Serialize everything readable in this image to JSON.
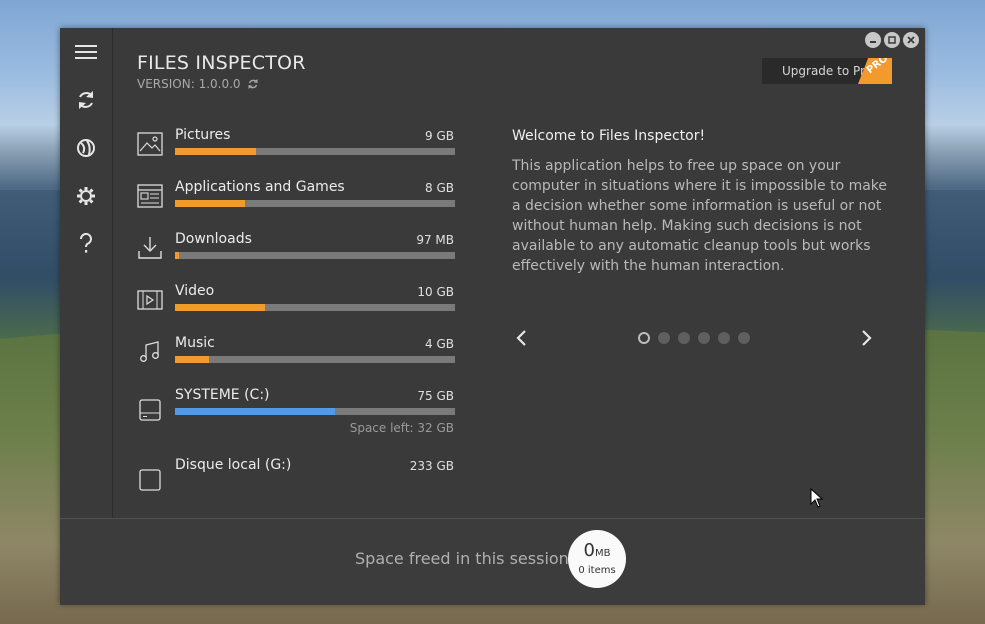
{
  "app": {
    "title": "FILES INSPECTOR",
    "version": "VERSION: 1.0.0.0",
    "upgrade_label": "Upgrade to Pro",
    "pro_badge": "PRO"
  },
  "sidebar": {
    "items": [
      {
        "icon": "menu-icon"
      },
      {
        "icon": "refresh-icon"
      },
      {
        "icon": "globe-icon"
      },
      {
        "icon": "gear-icon"
      },
      {
        "icon": "help-icon"
      }
    ]
  },
  "window_controls": [
    "minimize",
    "maximize",
    "close"
  ],
  "storage": {
    "items": [
      {
        "icon": "pictures-icon",
        "name": "Pictures",
        "size": "9 GB",
        "fill_percent": 29,
        "color": "#f39a2c"
      },
      {
        "icon": "apps-games-icon",
        "name": "Applications and Games",
        "size": "8 GB",
        "fill_percent": 25,
        "color": "#f39a2c"
      },
      {
        "icon": "downloads-icon",
        "name": "Downloads",
        "size": "97 MB",
        "fill_percent": 1.5,
        "color": "#f39a2c"
      },
      {
        "icon": "video-icon",
        "name": "Video",
        "size": "10 GB",
        "fill_percent": 32,
        "color": "#f39a2c"
      },
      {
        "icon": "music-icon",
        "name": "Music",
        "size": "4 GB",
        "fill_percent": 12,
        "color": "#f39a2c"
      },
      {
        "icon": "drive-icon",
        "name": "SYSTEME (C:)",
        "size": "75 GB",
        "fill_percent": 57,
        "color": "#4f9bea",
        "space_left": "Space left: 32 GB"
      },
      {
        "icon": "drive-icon",
        "name": "Disque local (G:)",
        "size": "233 GB"
      }
    ]
  },
  "welcome": {
    "title": "Welcome to Files Inspector!",
    "body": "This application helps to free up space on your computer in situations where it is impossible to make a decision whether some information is useful or not without human help. Making such decisions is not available to any automatic cleanup tools but works effectively with the human interaction.",
    "slide_count": 6,
    "active_slide": 1
  },
  "footer": {
    "label": "Space freed in this session:",
    "freed_value": "0",
    "freed_unit": "MB",
    "freed_items": "0 items"
  }
}
